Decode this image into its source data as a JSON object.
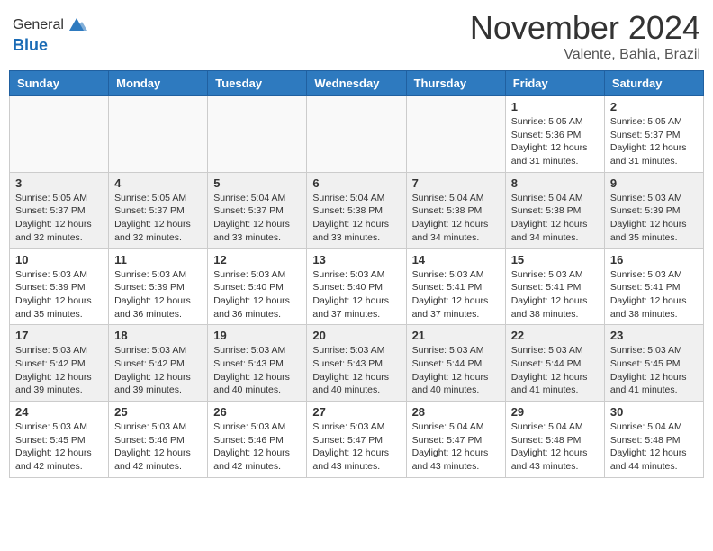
{
  "header": {
    "logo": {
      "general": "General",
      "blue": "Blue"
    },
    "title": "November 2024",
    "location": "Valente, Bahia, Brazil"
  },
  "weekdays": [
    "Sunday",
    "Monday",
    "Tuesday",
    "Wednesday",
    "Thursday",
    "Friday",
    "Saturday"
  ],
  "weeks": [
    {
      "shaded": false,
      "days": [
        {
          "num": "",
          "info": "",
          "empty": true
        },
        {
          "num": "",
          "info": "",
          "empty": true
        },
        {
          "num": "",
          "info": "",
          "empty": true
        },
        {
          "num": "",
          "info": "",
          "empty": true
        },
        {
          "num": "",
          "info": "",
          "empty": true
        },
        {
          "num": "1",
          "info": "Sunrise: 5:05 AM\nSunset: 5:36 PM\nDaylight: 12 hours\nand 31 minutes.",
          "empty": false
        },
        {
          "num": "2",
          "info": "Sunrise: 5:05 AM\nSunset: 5:37 PM\nDaylight: 12 hours\nand 31 minutes.",
          "empty": false
        }
      ]
    },
    {
      "shaded": true,
      "days": [
        {
          "num": "3",
          "info": "Sunrise: 5:05 AM\nSunset: 5:37 PM\nDaylight: 12 hours\nand 32 minutes.",
          "empty": false
        },
        {
          "num": "4",
          "info": "Sunrise: 5:05 AM\nSunset: 5:37 PM\nDaylight: 12 hours\nand 32 minutes.",
          "empty": false
        },
        {
          "num": "5",
          "info": "Sunrise: 5:04 AM\nSunset: 5:37 PM\nDaylight: 12 hours\nand 33 minutes.",
          "empty": false
        },
        {
          "num": "6",
          "info": "Sunrise: 5:04 AM\nSunset: 5:38 PM\nDaylight: 12 hours\nand 33 minutes.",
          "empty": false
        },
        {
          "num": "7",
          "info": "Sunrise: 5:04 AM\nSunset: 5:38 PM\nDaylight: 12 hours\nand 34 minutes.",
          "empty": false
        },
        {
          "num": "8",
          "info": "Sunrise: 5:04 AM\nSunset: 5:38 PM\nDaylight: 12 hours\nand 34 minutes.",
          "empty": false
        },
        {
          "num": "9",
          "info": "Sunrise: 5:03 AM\nSunset: 5:39 PM\nDaylight: 12 hours\nand 35 minutes.",
          "empty": false
        }
      ]
    },
    {
      "shaded": false,
      "days": [
        {
          "num": "10",
          "info": "Sunrise: 5:03 AM\nSunset: 5:39 PM\nDaylight: 12 hours\nand 35 minutes.",
          "empty": false
        },
        {
          "num": "11",
          "info": "Sunrise: 5:03 AM\nSunset: 5:39 PM\nDaylight: 12 hours\nand 36 minutes.",
          "empty": false
        },
        {
          "num": "12",
          "info": "Sunrise: 5:03 AM\nSunset: 5:40 PM\nDaylight: 12 hours\nand 36 minutes.",
          "empty": false
        },
        {
          "num": "13",
          "info": "Sunrise: 5:03 AM\nSunset: 5:40 PM\nDaylight: 12 hours\nand 37 minutes.",
          "empty": false
        },
        {
          "num": "14",
          "info": "Sunrise: 5:03 AM\nSunset: 5:41 PM\nDaylight: 12 hours\nand 37 minutes.",
          "empty": false
        },
        {
          "num": "15",
          "info": "Sunrise: 5:03 AM\nSunset: 5:41 PM\nDaylight: 12 hours\nand 38 minutes.",
          "empty": false
        },
        {
          "num": "16",
          "info": "Sunrise: 5:03 AM\nSunset: 5:41 PM\nDaylight: 12 hours\nand 38 minutes.",
          "empty": false
        }
      ]
    },
    {
      "shaded": true,
      "days": [
        {
          "num": "17",
          "info": "Sunrise: 5:03 AM\nSunset: 5:42 PM\nDaylight: 12 hours\nand 39 minutes.",
          "empty": false
        },
        {
          "num": "18",
          "info": "Sunrise: 5:03 AM\nSunset: 5:42 PM\nDaylight: 12 hours\nand 39 minutes.",
          "empty": false
        },
        {
          "num": "19",
          "info": "Sunrise: 5:03 AM\nSunset: 5:43 PM\nDaylight: 12 hours\nand 40 minutes.",
          "empty": false
        },
        {
          "num": "20",
          "info": "Sunrise: 5:03 AM\nSunset: 5:43 PM\nDaylight: 12 hours\nand 40 minutes.",
          "empty": false
        },
        {
          "num": "21",
          "info": "Sunrise: 5:03 AM\nSunset: 5:44 PM\nDaylight: 12 hours\nand 40 minutes.",
          "empty": false
        },
        {
          "num": "22",
          "info": "Sunrise: 5:03 AM\nSunset: 5:44 PM\nDaylight: 12 hours\nand 41 minutes.",
          "empty": false
        },
        {
          "num": "23",
          "info": "Sunrise: 5:03 AM\nSunset: 5:45 PM\nDaylight: 12 hours\nand 41 minutes.",
          "empty": false
        }
      ]
    },
    {
      "shaded": false,
      "days": [
        {
          "num": "24",
          "info": "Sunrise: 5:03 AM\nSunset: 5:45 PM\nDaylight: 12 hours\nand 42 minutes.",
          "empty": false
        },
        {
          "num": "25",
          "info": "Sunrise: 5:03 AM\nSunset: 5:46 PM\nDaylight: 12 hours\nand 42 minutes.",
          "empty": false
        },
        {
          "num": "26",
          "info": "Sunrise: 5:03 AM\nSunset: 5:46 PM\nDaylight: 12 hours\nand 42 minutes.",
          "empty": false
        },
        {
          "num": "27",
          "info": "Sunrise: 5:03 AM\nSunset: 5:47 PM\nDaylight: 12 hours\nand 43 minutes.",
          "empty": false
        },
        {
          "num": "28",
          "info": "Sunrise: 5:04 AM\nSunset: 5:47 PM\nDaylight: 12 hours\nand 43 minutes.",
          "empty": false
        },
        {
          "num": "29",
          "info": "Sunrise: 5:04 AM\nSunset: 5:48 PM\nDaylight: 12 hours\nand 43 minutes.",
          "empty": false
        },
        {
          "num": "30",
          "info": "Sunrise: 5:04 AM\nSunset: 5:48 PM\nDaylight: 12 hours\nand 44 minutes.",
          "empty": false
        }
      ]
    }
  ]
}
